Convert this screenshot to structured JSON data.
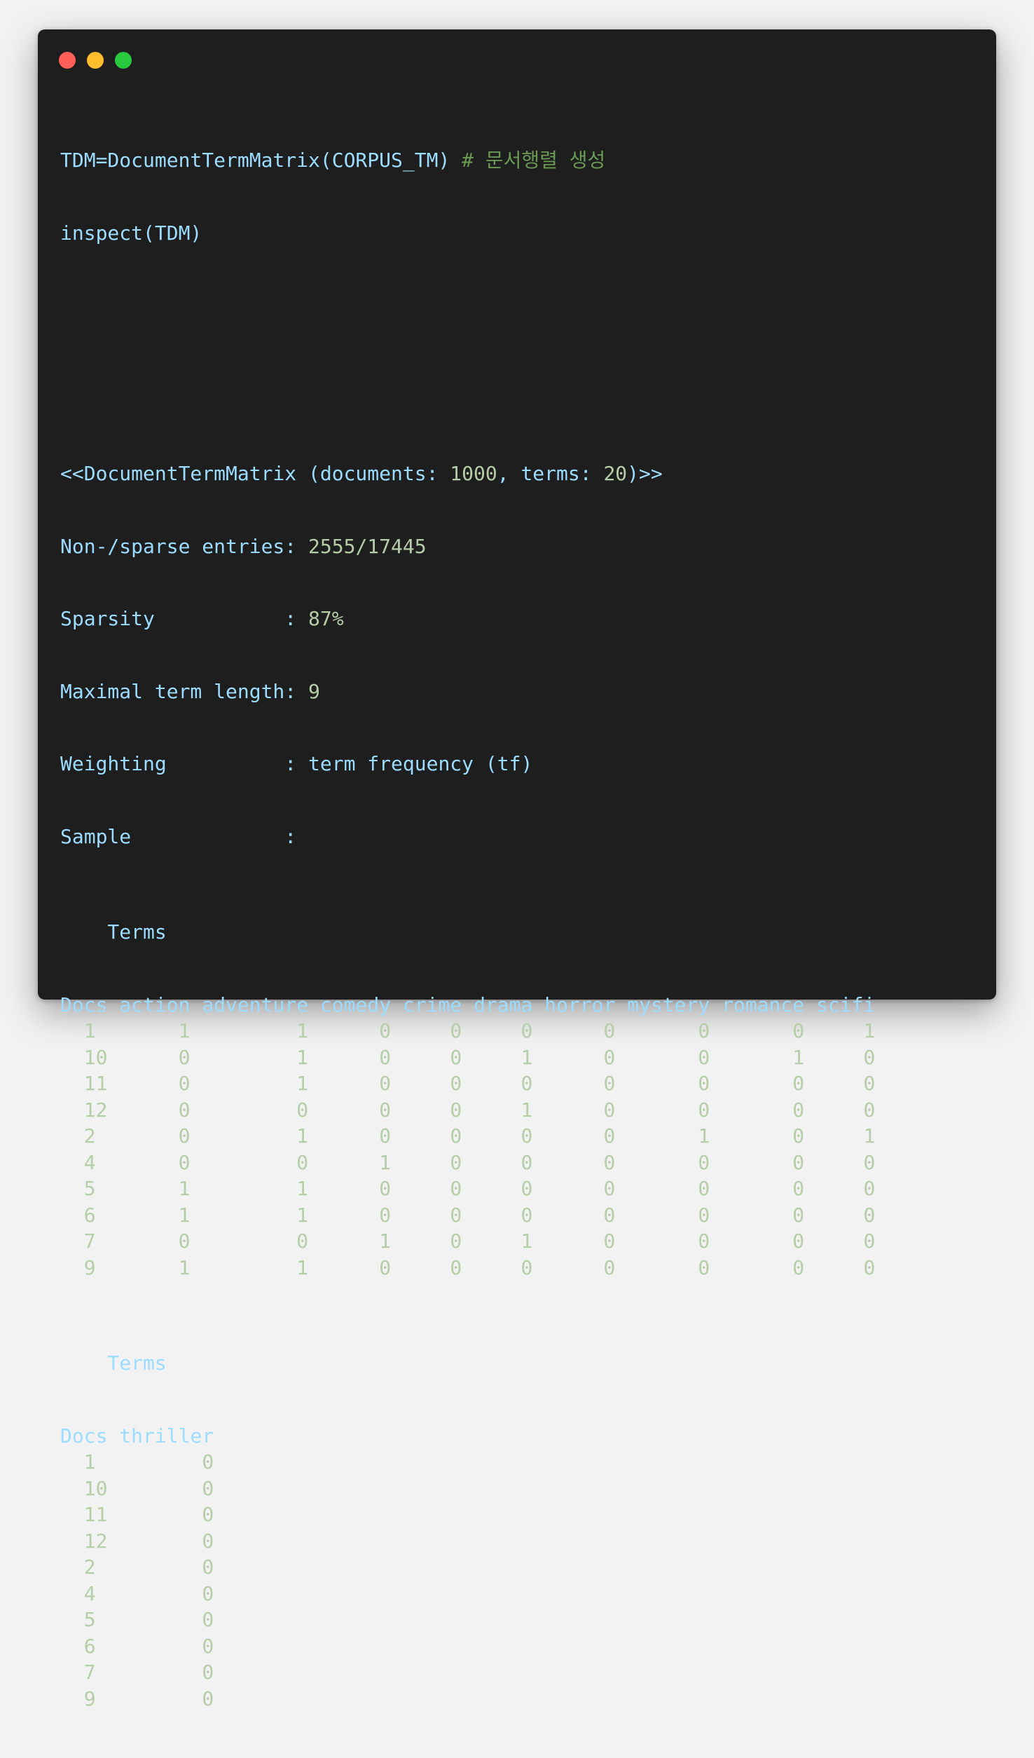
{
  "window": {
    "buttons": [
      "close",
      "minimize",
      "maximize"
    ],
    "colors": {
      "close": "#ff5f56",
      "minimize": "#ffbd2e",
      "maximize": "#27c93f",
      "background": "#1e1e1e"
    }
  },
  "code": {
    "line1_code": "TDM=DocumentTermMatrix(CORPUS_TM)",
    "line1_comment": "# 문서행렬 생성",
    "line2_code": "inspect(TDM)"
  },
  "output": {
    "header_prefix": "<<DocumentTermMatrix (documents: ",
    "documents": "1000",
    "header_mid": ", terms: ",
    "terms": "20",
    "header_suffix": ")>>",
    "nonsparse_label": "Non-/sparse entries: ",
    "nonsparse_value": "2555/17445",
    "sparsity_label": "Sparsity           : ",
    "sparsity_value": "87%",
    "maxlen_label": "Maximal term length: ",
    "maxlen_value": "9",
    "weighting_label": "Weighting          : ",
    "weighting_value": "term frequency (tf)",
    "sample_label": "Sample             :",
    "terms_label": "    Terms",
    "docs_label": "Docs",
    "table1": {
      "columns": [
        "action",
        "adventure",
        "comedy",
        "crime",
        "drama",
        "horror",
        "mystery",
        "romance",
        "scifi"
      ],
      "rows": [
        {
          "doc": "1",
          "values": [
            "1",
            "1",
            "0",
            "0",
            "0",
            "0",
            "0",
            "0",
            "1"
          ]
        },
        {
          "doc": "10",
          "values": [
            "0",
            "1",
            "0",
            "0",
            "1",
            "0",
            "0",
            "1",
            "0"
          ]
        },
        {
          "doc": "11",
          "values": [
            "0",
            "1",
            "0",
            "0",
            "0",
            "0",
            "0",
            "0",
            "0"
          ]
        },
        {
          "doc": "12",
          "values": [
            "0",
            "0",
            "0",
            "0",
            "1",
            "0",
            "0",
            "0",
            "0"
          ]
        },
        {
          "doc": "2",
          "values": [
            "0",
            "1",
            "0",
            "0",
            "0",
            "0",
            "1",
            "0",
            "1"
          ]
        },
        {
          "doc": "4",
          "values": [
            "0",
            "0",
            "1",
            "0",
            "0",
            "0",
            "0",
            "0",
            "0"
          ]
        },
        {
          "doc": "5",
          "values": [
            "1",
            "1",
            "0",
            "0",
            "0",
            "0",
            "0",
            "0",
            "0"
          ]
        },
        {
          "doc": "6",
          "values": [
            "1",
            "1",
            "0",
            "0",
            "0",
            "0",
            "0",
            "0",
            "0"
          ]
        },
        {
          "doc": "7",
          "values": [
            "0",
            "0",
            "1",
            "0",
            "1",
            "0",
            "0",
            "0",
            "0"
          ]
        },
        {
          "doc": "9",
          "values": [
            "1",
            "1",
            "0",
            "0",
            "0",
            "0",
            "0",
            "0",
            "0"
          ]
        }
      ]
    },
    "table2": {
      "columns": [
        "thriller"
      ],
      "rows": [
        {
          "doc": "1",
          "values": [
            "0"
          ]
        },
        {
          "doc": "10",
          "values": [
            "0"
          ]
        },
        {
          "doc": "11",
          "values": [
            "0"
          ]
        },
        {
          "doc": "12",
          "values": [
            "0"
          ]
        },
        {
          "doc": "2",
          "values": [
            "0"
          ]
        },
        {
          "doc": "4",
          "values": [
            "0"
          ]
        },
        {
          "doc": "5",
          "values": [
            "0"
          ]
        },
        {
          "doc": "6",
          "values": [
            "0"
          ]
        },
        {
          "doc": "7",
          "values": [
            "0"
          ]
        },
        {
          "doc": "9",
          "values": [
            "0"
          ]
        }
      ]
    }
  }
}
